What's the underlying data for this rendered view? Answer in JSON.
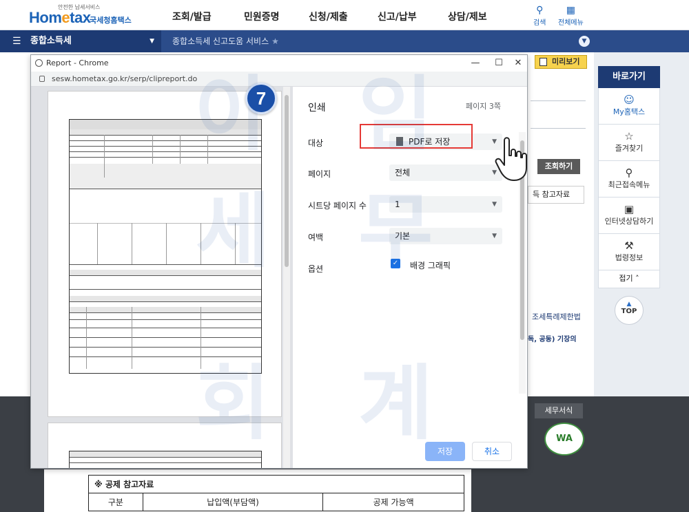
{
  "header": {
    "logo_small": "안전한 납세서비스",
    "logo_brand_a": "Hom",
    "logo_brand_b": "e",
    "logo_brand_c": "tax",
    "logo_sub": "국세청홈택스",
    "menu": [
      "조회/발급",
      "민원증명",
      "신청/제출",
      "신고/납부",
      "상담/제보"
    ],
    "search_label": "검색",
    "all_menu_label": "전체메뉴"
  },
  "navbar": {
    "section": "종합소득세",
    "breadcrumb": "종합소득세 신고도움 서비스"
  },
  "page": {
    "preview_label": "미리보기",
    "lookup_label": "조회하기",
    "reference_label": "득 참고자료",
    "tax_limit_text": "조세특례제한법",
    "note_text": "독, 공동) 기장의",
    "tax_forms_label": "세무서식",
    "wa_label": "WA",
    "bottom_table": {
      "title": "※ 공제 참고자료",
      "headers": [
        "구분",
        "납입액(부담액)",
        "공제 가능액"
      ]
    }
  },
  "quick_links": {
    "title": "바로가기",
    "items": [
      {
        "label": "My홈택스",
        "icon": "person-icon"
      },
      {
        "label": "즐겨찾기",
        "icon": "star-icon"
      },
      {
        "label": "최근접속메뉴",
        "icon": "recent-icon"
      },
      {
        "label": "인터넷상담하기",
        "icon": "monitor-icon"
      },
      {
        "label": "법령정보",
        "icon": "gavel-icon"
      }
    ],
    "fold_label": "접기",
    "top_label": "TOP"
  },
  "dialog": {
    "window_title": "Report - Chrome",
    "url": "sesw.hometax.go.kr/serp/clipreport.do",
    "print_title": "인쇄",
    "page_count": "페이지 3쪽",
    "destination_label": "대상",
    "destination_value": "PDF로 저장",
    "pages_label": "페이지",
    "pages_value": "전체",
    "per_sheet_label": "시트당 페이지 수",
    "per_sheet_value": "1",
    "margins_label": "여백",
    "margins_value": "기본",
    "options_label": "옵션",
    "background_graphics_label": "배경 그래픽",
    "background_graphics_checked": true,
    "save_label": "저장",
    "cancel_label": "취소"
  },
  "step_badge": "7",
  "watermark": {
    "a": "아",
    "b": "임",
    "c": "세",
    "d": "무",
    "e": "회",
    "f": "계"
  },
  "colors": {
    "brand_blue": "#1c63b7",
    "nav_dark": "#1d3a73",
    "highlight_red": "#e53935",
    "chrome_blue": "#1a73e8"
  }
}
